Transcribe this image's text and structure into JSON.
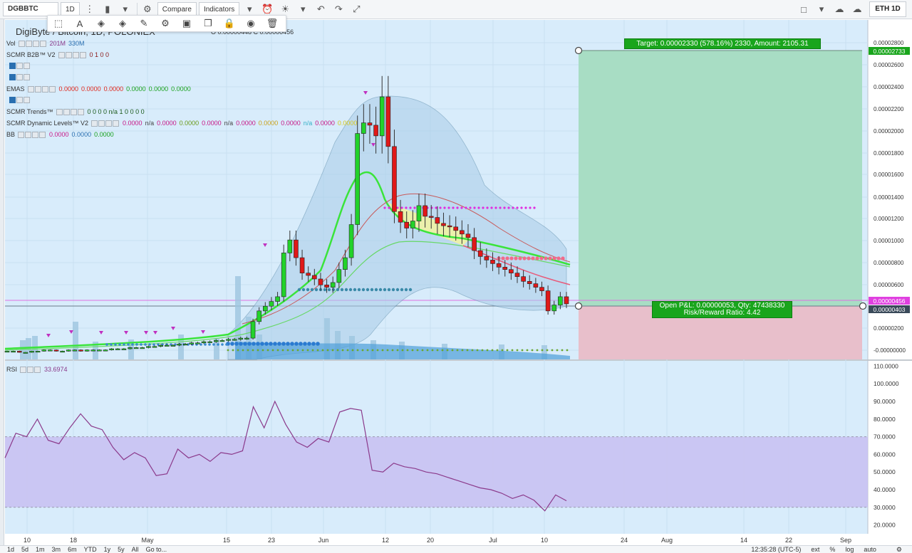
{
  "toolbar": {
    "symbol": "DGBBTC",
    "interval": "1D",
    "compare_label": "Compare",
    "indicators_label": "Indicators",
    "eth_label": "ETH 1D"
  },
  "chart_header": {
    "pair_title": "DigiByte / Bitcoin, 1D, POLONIEX",
    "ohlc_text": "O 0.00000448 C 0.00000456"
  },
  "legends": [
    {
      "name": "Vol",
      "values": [
        {
          "text": "201M",
          "color": "#8b3a8b"
        },
        {
          "text": "330M",
          "color": "#2a6fb0"
        }
      ]
    },
    {
      "name": "SCMR B2B™ V2",
      "values": [
        {
          "text": "0 1 0 0",
          "color": "#8b1a1a"
        }
      ]
    },
    {
      "name": "",
      "values": []
    },
    {
      "name": "",
      "values": []
    },
    {
      "name": "EMAS",
      "values": [
        {
          "text": "0.0000",
          "color": "#e0271b"
        },
        {
          "text": "0.0000",
          "color": "#e0271b"
        },
        {
          "text": "0.0000",
          "color": "#e0271b"
        },
        {
          "text": "0.0000",
          "color": "#17a01b"
        },
        {
          "text": "0.0000",
          "color": "#17a01b"
        },
        {
          "text": "0.0000",
          "color": "#17a01b"
        }
      ]
    },
    {
      "name": "",
      "values": []
    },
    {
      "name": "SCMR Trends™",
      "values": [
        {
          "text": "0 0 0 0 n/a 1 0 0 0 0",
          "color": "#1c5a1c"
        }
      ]
    },
    {
      "name": "SCMR Dynamic Levels™ V2",
      "values": [
        {
          "text": "0.0000",
          "color": "#c71585"
        },
        {
          "text": "n/a",
          "color": "#444444"
        },
        {
          "text": "0.0000",
          "color": "#c71585"
        },
        {
          "text": "0.0000",
          "color": "#6a9a1a"
        },
        {
          "text": "0.0000",
          "color": "#c71585"
        },
        {
          "text": "n/a",
          "color": "#444444"
        },
        {
          "text": "0.0000",
          "color": "#c71585"
        },
        {
          "text": "0.0000",
          "color": "#c9a21a"
        },
        {
          "text": "0.0000",
          "color": "#c71585"
        },
        {
          "text": "n/a",
          "color": "#38b0c8"
        },
        {
          "text": "0.0000",
          "color": "#c71585"
        },
        {
          "text": "0.0000",
          "color": "#d8c81a"
        }
      ]
    },
    {
      "name": "BB",
      "values": [
        {
          "text": "0.0000",
          "color": "#c71585"
        },
        {
          "text": "0.0000",
          "color": "#2a6fb0"
        },
        {
          "text": "0.0000",
          "color": "#17a01b"
        }
      ]
    }
  ],
  "rsi_legend": {
    "name": "RSI",
    "value": "33.6974"
  },
  "trade": {
    "target_text": "Target: 0.00002330 (578.16%) 2330, Amount: 2105.31",
    "pnl_line1": "Open P&L: 0.00000053, Qty: 47438330",
    "pnl_line2": "Risk/Reward Ratio: 4.42"
  },
  "price_badges": {
    "target": "0.00002733",
    "current": "0.00000456",
    "entry": "0.00000403"
  },
  "bottombar": {
    "ranges": [
      "1d",
      "5d",
      "1m",
      "3m",
      "6m",
      "YTD",
      "1y",
      "5y",
      "All",
      "Go to..."
    ],
    "clock": "12:35:28 (UTC-5)",
    "right_items": [
      "ext",
      "%",
      "log",
      "auto"
    ]
  },
  "chart_data": [
    {
      "type": "candlestick",
      "title": "",
      "x_tick_labels": [
        "10",
        "18",
        "May",
        "15",
        "23",
        "Jun",
        "12",
        "20",
        "Jul",
        "10",
        "24",
        "Aug",
        "14",
        "22",
        "Sep"
      ],
      "ylabel": "",
      "y_tick_labels": [
        "0.00002800",
        "0.00002600",
        "0.00002400",
        "0.00002200",
        "0.00002000",
        "0.00001800",
        "0.00001600",
        "0.00001400",
        "0.00001200",
        "0.00001000",
        "0.00000800",
        "0.00000600",
        "0.00000200",
        "-0.00000000"
      ],
      "ylim": [
        -2e-07,
        2.85e-05
      ],
      "candles_close": [
        5e-07,
        5e-07,
        4e-07,
        4e-07,
        5e-07,
        5e-07,
        6e-07,
        6e-07,
        5e-07,
        5e-07,
        6e-07,
        6e-07,
        5e-07,
        6e-07,
        6e-07,
        6e-07,
        6e-07,
        7e-07,
        7e-07,
        7e-07,
        8e-07,
        8e-07,
        8e-07,
        9e-07,
        9e-07,
        1e-06,
        1e-06,
        1e-06,
        1.1e-06,
        1.1e-06,
        1.2e-06,
        1.2e-06,
        1.3e-06,
        1.3e-06,
        1.4e-06,
        1.4e-06,
        1.5e-06,
        1.5e-06,
        1.6e-06,
        1.6e-06,
        3e-06,
        3.9e-06,
        4.3e-06,
        4.7e-06,
        5.1e-06,
        8.8e-06,
        9.9e-06,
        8.4e-06,
        7.1e-06,
        6.9e-06,
        6.6e-06,
        6.1e-06,
        5.9e-06,
        6.3e-06,
        7.4e-06,
        8.4e-06,
        1.12e-05,
        1.89e-05,
        1.98e-05,
        1.96e-05,
        1.87e-05,
        2.2e-05,
        1.78e-05,
        1.23e-05,
        1.14e-05,
        1.09e-05,
        1.15e-05,
        1.28e-05,
        1.19e-05,
        1.18e-05,
        1.13e-05,
        1.11e-05,
        1.1e-05,
        1.07e-05,
        1.04e-05,
        1.01e-05,
        9e-06,
        8.5e-06,
        8.2e-06,
        7.9e-06,
        7.6e-06,
        7.4e-06,
        7.1e-06,
        6.8e-06,
        6.4e-06,
        6.2e-06,
        5.9e-06,
        5.6e-06,
        3.9e-06,
        4.4e-06,
        5.1e-06,
        4.5e-06
      ],
      "trade_levels": {
        "target": 2.733e-05,
        "entry": 4.03e-06,
        "stop": -2e-07
      },
      "current_price": 4.56e-06
    },
    {
      "type": "line",
      "title": "",
      "series": [
        {
          "name": "RSI",
          "values": [
            58,
            72,
            70,
            80,
            68,
            66,
            75,
            83,
            76,
            74,
            64,
            57,
            61,
            58,
            48,
            49,
            63,
            58,
            60,
            56,
            61,
            60,
            62,
            87,
            75,
            90,
            77,
            67,
            64,
            69,
            67,
            84,
            86,
            85,
            51,
            50,
            55,
            53,
            52,
            50,
            49,
            47,
            45,
            43,
            41,
            40,
            38,
            35,
            37,
            34,
            28,
            37,
            33.6974
          ]
        }
      ],
      "y_tick_labels": [
        "110.0000",
        "100.0000",
        "90.0000",
        "80.0000",
        "70.0000",
        "60.0000",
        "50.0000",
        "40.0000",
        "30.0000",
        "20.0000"
      ],
      "ylim": [
        15,
        113
      ],
      "bands": [
        30,
        70
      ]
    }
  ]
}
